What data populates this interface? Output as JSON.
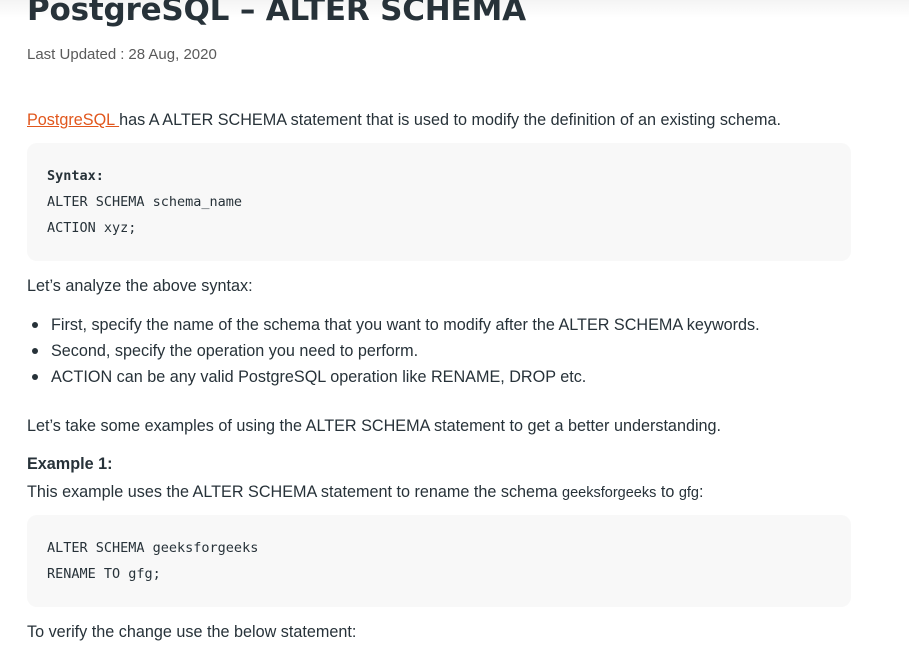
{
  "article": {
    "title": "PostgreSQL – ALTER SCHEMA",
    "last_updated_label": "Last Updated",
    "last_updated_sep": ":",
    "last_updated_date": "28 Aug, 2020",
    "intro": {
      "link_text": "PostgreSQL ",
      "rest": "has A ALTER SCHEMA statement that is used to modify the definition of an existing schema."
    },
    "syntax_block": {
      "heading": "Syntax:",
      "lines": [
        "ALTER SCHEMA schema_name",
        "ACTION xyz;"
      ]
    },
    "analyze_text": "Let’s analyze the above syntax:",
    "bullets": [
      "First, specify the name of the schema that you want to modify after the ALTER SCHEMA keywords.",
      "Second, specify the operation you need to perform.",
      "ACTION can be any valid PostgreSQL operation like RENAME, DROP etc."
    ],
    "examples_intro": "Let’s take some examples of using the ALTER SCHEMA statement to get a better understanding.",
    "example1": {
      "heading": "Example 1:",
      "text_before": "This example uses the ALTER SCHEMA statement to rename the schema ",
      "old_name": "geeksforgeeks",
      "text_mid": " to ",
      "new_name": "gfg",
      "text_after": ":",
      "code_lines": [
        "ALTER SCHEMA geeksforgeeks",
        "RENAME TO gfg;"
      ]
    },
    "verify_text": "To verify the change use the below statement:"
  }
}
